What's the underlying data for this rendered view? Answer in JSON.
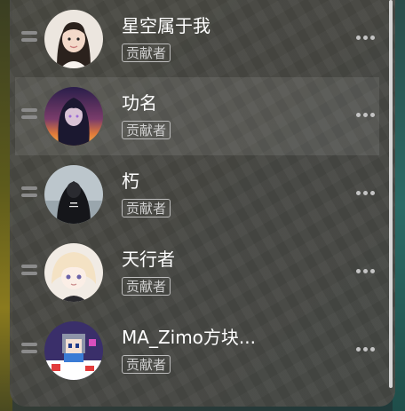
{
  "members": [
    {
      "name": "星空属于我",
      "role": "贡献者",
      "highlighted": false
    },
    {
      "name": "功名",
      "role": "贡献者",
      "highlighted": true
    },
    {
      "name": "朽",
      "role": "贡献者",
      "highlighted": false
    },
    {
      "name": "天行者",
      "role": "贡献者",
      "highlighted": false
    },
    {
      "name": "MA_Zimo方块...",
      "role": "贡献者",
      "highlighted": false
    }
  ],
  "colors": {
    "panel": "#484844",
    "text": "#ffffff",
    "badge_border": "#bdbdbd",
    "highlight": "rgba(255,255,255,0.09)"
  },
  "icons": {
    "drag": "drag-handle-icon",
    "more": "more-dots-icon"
  }
}
